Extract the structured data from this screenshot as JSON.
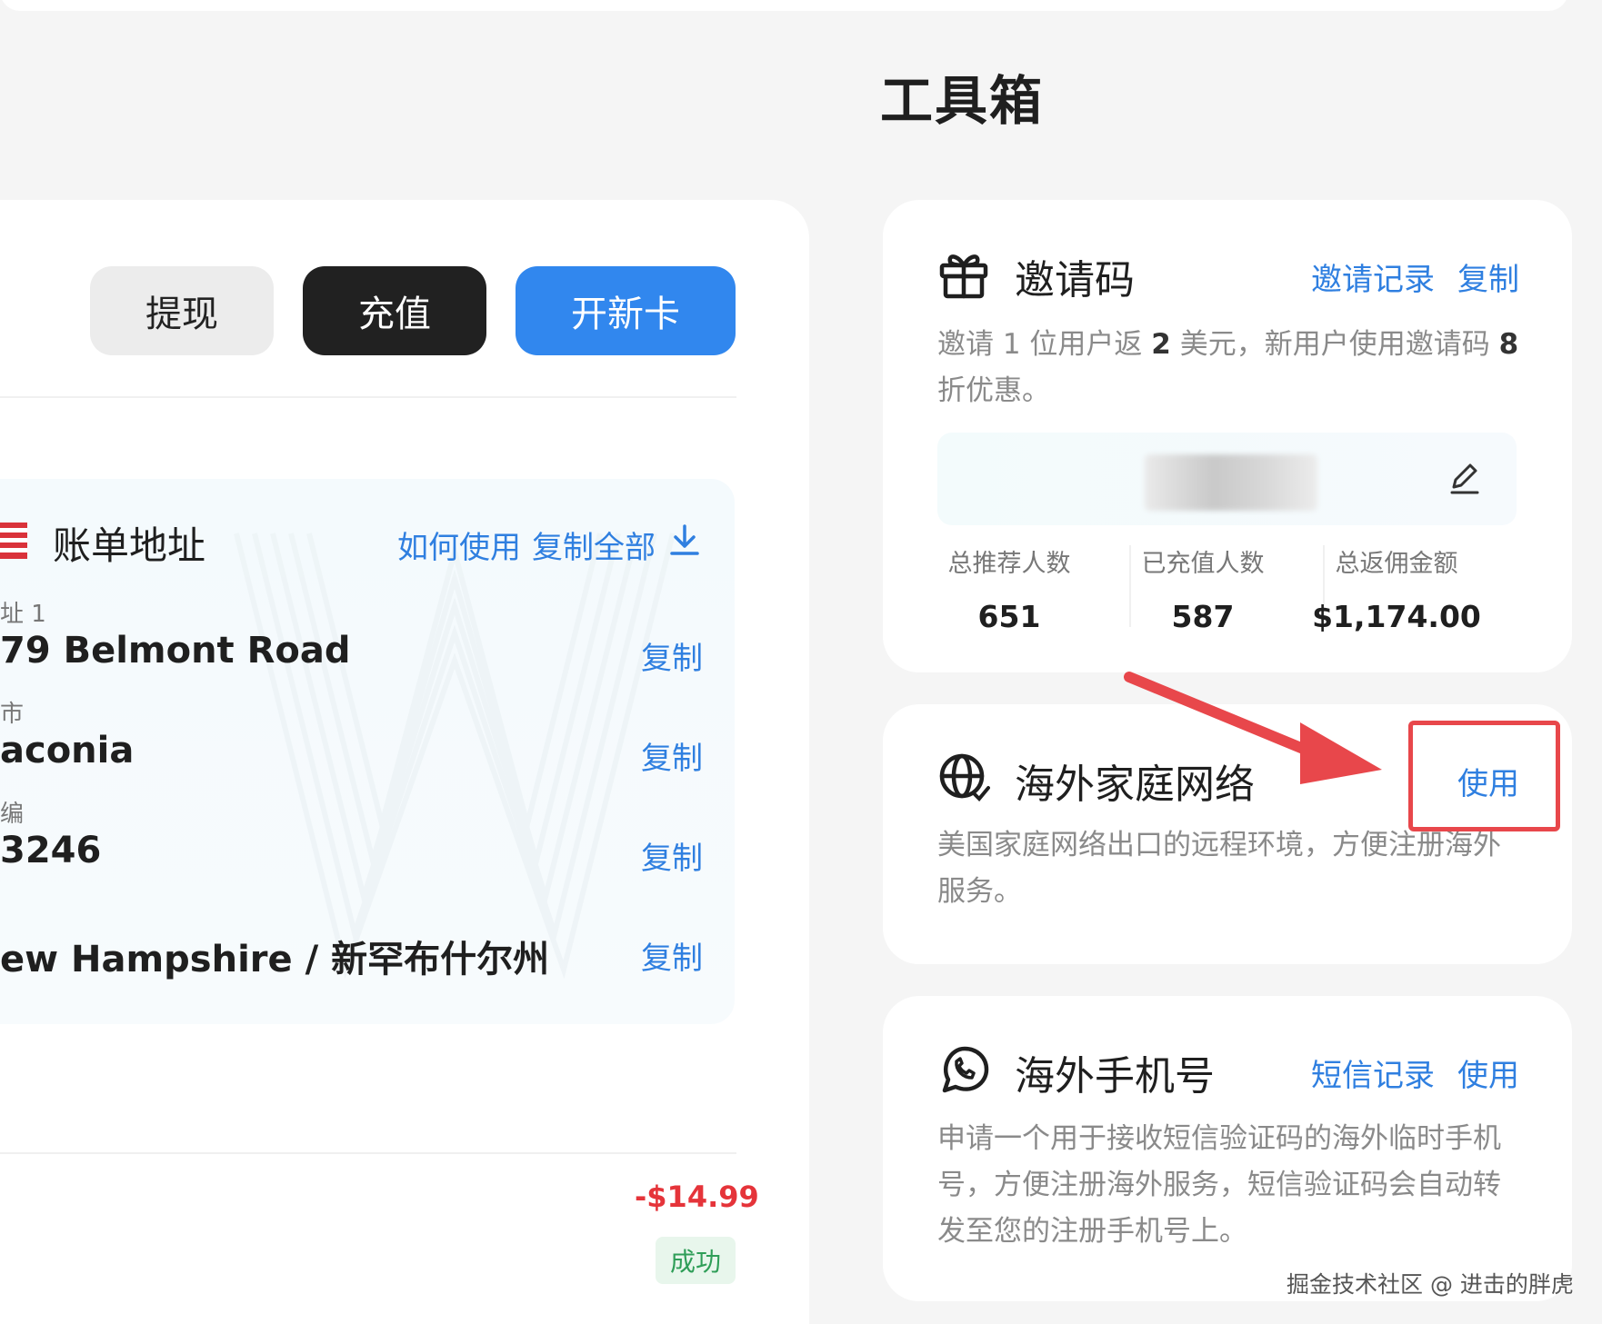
{
  "page": {
    "title": "工具箱"
  },
  "actions": {
    "withdraw": "提现",
    "recharge": "充值",
    "new_card": "开新卡"
  },
  "billing_address": {
    "title": "账单地址",
    "how_to_use": "如何使用",
    "copy_all": "复制全部",
    "fields": [
      {
        "label": "址 1",
        "value": "79 Belmont Road",
        "copy": "复制"
      },
      {
        "label": "市",
        "value": "aconia",
        "copy": "复制"
      },
      {
        "label": "编",
        "value": "3246",
        "copy": "复制"
      },
      {
        "label": "",
        "value": "ew Hampshire / 新罕布什尔州",
        "copy": "复制"
      }
    ]
  },
  "transaction": {
    "amount": "-$14.99",
    "status": "成功"
  },
  "invite_card": {
    "title": "邀请码",
    "records_link": "邀请记录",
    "copy_link": "复制",
    "desc_1": "邀请 1 位用户返 ",
    "desc_num1": "2",
    "desc_2": " 美元，新用户使用邀请码 ",
    "desc_num2": "8",
    "desc_3": " 折优惠。",
    "stats": [
      {
        "label": "总推荐人数",
        "value": "651"
      },
      {
        "label": "已充值人数",
        "value": "587"
      },
      {
        "label": "总返佣金额",
        "value": "$1,174.00"
      }
    ]
  },
  "network_card": {
    "title": "海外家庭网络",
    "use_link": "使用",
    "desc": "美国家庭网络出口的远程环境，方便注册海外服务。"
  },
  "phone_card": {
    "title": "海外手机号",
    "sms_link": "短信记录",
    "use_link": "使用",
    "desc": "申请一个用于接收短信验证码的海外临时手机号，方便注册海外服务，短信验证码会自动转发至您的注册手机号上。"
  },
  "footer": {
    "watermark": "掘金技术社区 @ 进击的胖虎"
  },
  "colors": {
    "accent": "#3187ee",
    "link": "#2f7fe0",
    "danger": "#e5343a",
    "success": "#2f9e58",
    "annotation": "#e8474b"
  },
  "icons": {
    "invite": "gift-icon",
    "network": "globe-icon",
    "phone": "whatsapp-icon",
    "billing": "us-flag-icon",
    "download": "download-icon",
    "edit": "edit-pencil-icon"
  }
}
